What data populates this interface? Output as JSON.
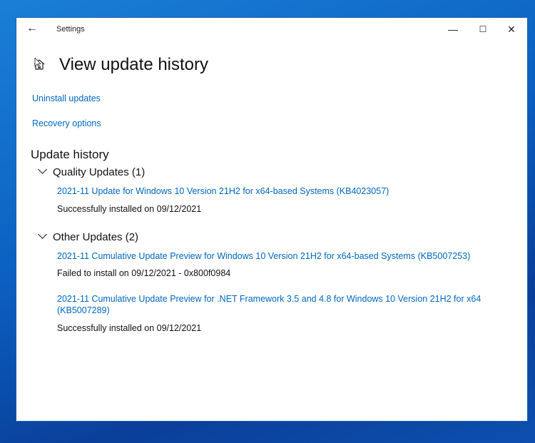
{
  "window": {
    "title": "Settings",
    "minimize": "—",
    "maximize": "☐",
    "close": "✕",
    "back": "←"
  },
  "page": {
    "title": "View update history",
    "icon": "home-icon"
  },
  "links": {
    "uninstall": "Uninstall updates",
    "recovery": "Recovery options"
  },
  "history": {
    "heading": "Update history",
    "groups": [
      {
        "label": "Quality Updates (1)",
        "items": [
          {
            "name": "2021-11 Update for Windows 10 Version 21H2 for x64-based Systems (KB4023057)",
            "status": "Successfully installed on 09/12/2021"
          }
        ]
      },
      {
        "label": "Other Updates (2)",
        "items": [
          {
            "name": "2021-11 Cumulative Update Preview for Windows 10 Version 21H2 for x64-based Systems (KB5007253)",
            "status": "Failed to install on 09/12/2021 - 0x800f0984"
          },
          {
            "name": "2021-11 Cumulative Update Preview for .NET Framework 3.5 and 4.8 for Windows 10 Version 21H2 for x64 (KB5007289)",
            "status": "Successfully installed on 09/12/2021"
          }
        ]
      }
    ]
  },
  "colors": {
    "link": "#0067c0",
    "desktop": "#0b5fc0"
  }
}
